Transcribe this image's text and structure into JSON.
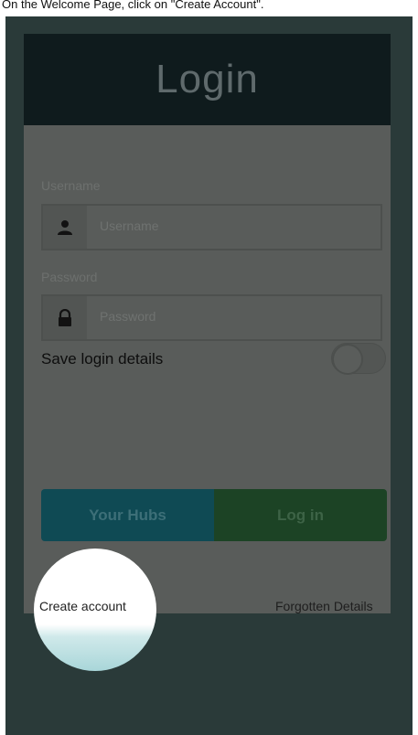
{
  "instruction": "On the Welcome Page, click on \"Create Account\".",
  "header": {
    "title": "Login"
  },
  "form": {
    "username_label": "Username",
    "username_placeholder": "Username",
    "password_label": "Password",
    "password_placeholder": "Password",
    "save_label": "Save login details"
  },
  "buttons": {
    "your_hubs": "Your Hubs",
    "log_in": "Log in"
  },
  "links": {
    "create_account": "Create account",
    "forgotten_details": "Forgotten Details"
  },
  "colors": {
    "header_bg": "#0f1b1d",
    "hubs_btn": "#0f4a54",
    "login_btn": "#1c4325",
    "overlay": "#2a3a39"
  },
  "icons": [
    "user-icon",
    "lock-icon"
  ]
}
